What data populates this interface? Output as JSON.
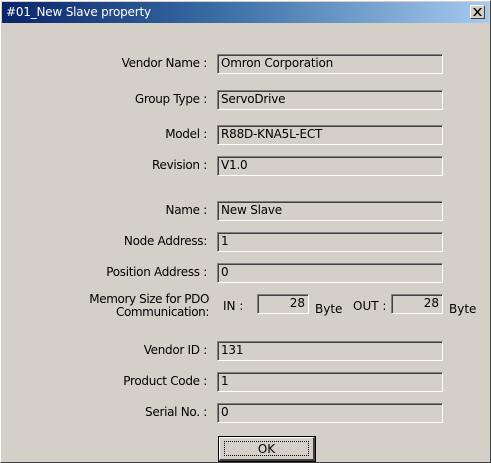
{
  "window": {
    "title": "#01_New Slave property",
    "close_glyph": "×"
  },
  "fields": [
    {
      "key": "vendor_name",
      "label": "Vendor Name :",
      "value": "Omron Corporation"
    },
    {
      "key": "group_type",
      "label": "Group Type :",
      "value": "ServoDrive"
    },
    {
      "key": "model",
      "label": "Model :",
      "value": "R88D-KNA5L-ECT"
    },
    {
      "key": "revision",
      "label": "Revision :",
      "value": "V1.0"
    },
    {
      "key": "name",
      "label": "Name :",
      "value": "New Slave"
    },
    {
      "key": "node_address",
      "label": "Node Address:",
      "value": "1"
    },
    {
      "key": "position_address",
      "label": "Position Address :",
      "value": "0"
    },
    {
      "key": "vendor_id",
      "label": "Vendor ID :",
      "value": "131"
    },
    {
      "key": "product_code",
      "label": "Product Code :",
      "value": "1"
    },
    {
      "key": "serial_no",
      "label": "Serial No. :",
      "value": "0"
    }
  ],
  "memory": {
    "label_line1": "Memory Size for PDO",
    "label_line2": "Communication:",
    "in_label": "IN :",
    "in_value": "28",
    "in_unit": "Byte",
    "out_label": "OUT :",
    "out_value": "28",
    "out_unit": "Byte"
  },
  "buttons": {
    "ok_label": "OK"
  },
  "colors": {
    "title_bar_start": "#0a246a",
    "title_bar_end": "#a6caf0",
    "dialog_bg": "#d4d0c8"
  }
}
